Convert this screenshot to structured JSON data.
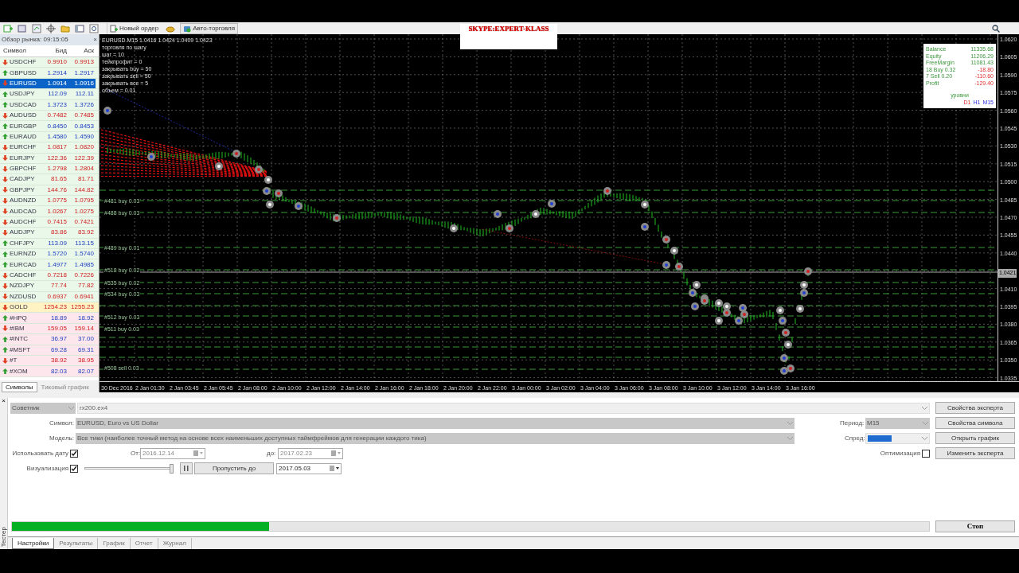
{
  "toolbar": {
    "buttons": [
      {
        "label": "Новый ордер"
      },
      {
        "label": "Авто-торговля"
      }
    ]
  },
  "market_watch": {
    "title": "Обзор рынка: 09:15:05",
    "close": "×",
    "columns": [
      "Символ",
      "Бид",
      "Аск"
    ],
    "rows": [
      {
        "symbol": "USDCHF",
        "bid": "0.9910",
        "ask": "0.9913",
        "rising": false,
        "kind": "forex",
        "selected": false
      },
      {
        "symbol": "GBPUSD",
        "bid": "1.2914",
        "ask": "1.2917",
        "rising": true,
        "kind": "forex",
        "selected": false
      },
      {
        "symbol": "EURUSD",
        "bid": "1.0914",
        "ask": "1.0916",
        "rising": false,
        "kind": "forex",
        "selected": true
      },
      {
        "symbol": "USDJPY",
        "bid": "112.09",
        "ask": "112.11",
        "rising": true,
        "kind": "forex",
        "selected": false
      },
      {
        "symbol": "USDCAD",
        "bid": "1.3723",
        "ask": "1.3726",
        "rising": true,
        "kind": "forex",
        "selected": false
      },
      {
        "symbol": "AUDUSD",
        "bid": "0.7482",
        "ask": "0.7485",
        "rising": false,
        "kind": "forex",
        "selected": false
      },
      {
        "symbol": "EURGBP",
        "bid": "0.8450",
        "ask": "0.8453",
        "rising": true,
        "kind": "forex",
        "selected": false
      },
      {
        "symbol": "EURAUD",
        "bid": "1.4580",
        "ask": "1.4590",
        "rising": true,
        "kind": "forex",
        "selected": false
      },
      {
        "symbol": "EURCHF",
        "bid": "1.0817",
        "ask": "1.0820",
        "rising": false,
        "kind": "forex",
        "selected": false
      },
      {
        "symbol": "EURJPY",
        "bid": "122.36",
        "ask": "122.39",
        "rising": false,
        "kind": "forex",
        "selected": false
      },
      {
        "symbol": "GBPCHF",
        "bid": "1.2798",
        "ask": "1.2804",
        "rising": false,
        "kind": "forex",
        "selected": false
      },
      {
        "symbol": "CADJPY",
        "bid": "81.65",
        "ask": "81.71",
        "rising": false,
        "kind": "forex",
        "selected": false
      },
      {
        "symbol": "GBPJPY",
        "bid": "144.76",
        "ask": "144.82",
        "rising": false,
        "kind": "forex",
        "selected": false
      },
      {
        "symbol": "AUDNZD",
        "bid": "1.0775",
        "ask": "1.0795",
        "rising": false,
        "kind": "forex",
        "selected": false
      },
      {
        "symbol": "AUDCAD",
        "bid": "1.0267",
        "ask": "1.0275",
        "rising": false,
        "kind": "forex",
        "selected": false
      },
      {
        "symbol": "AUDCHF",
        "bid": "0.7415",
        "ask": "0.7421",
        "rising": false,
        "kind": "forex",
        "selected": false
      },
      {
        "symbol": "AUDJPY",
        "bid": "83.86",
        "ask": "83.92",
        "rising": false,
        "kind": "forex",
        "selected": false
      },
      {
        "symbol": "CHFJPY",
        "bid": "113.09",
        "ask": "113.15",
        "rising": true,
        "kind": "forex",
        "selected": false
      },
      {
        "symbol": "EURNZD",
        "bid": "1.5720",
        "ask": "1.5740",
        "rising": true,
        "kind": "forex",
        "selected": false
      },
      {
        "symbol": "EURCAD",
        "bid": "1.4977",
        "ask": "1.4985",
        "rising": true,
        "kind": "forex",
        "selected": false
      },
      {
        "symbol": "CADCHF",
        "bid": "0.7218",
        "ask": "0.7226",
        "rising": false,
        "kind": "forex",
        "selected": false
      },
      {
        "symbol": "NZDJPY",
        "bid": "77.74",
        "ask": "77.82",
        "rising": false,
        "kind": "forex",
        "selected": false
      },
      {
        "symbol": "NZDUSD",
        "bid": "0.6937",
        "ask": "0.6941",
        "rising": false,
        "kind": "forex",
        "selected": false
      },
      {
        "symbol": "GOLD",
        "bid": "1254.23",
        "ask": "1255.23",
        "rising": false,
        "kind": "metal",
        "selected": false
      },
      {
        "symbol": "#HPQ",
        "bid": "18.89",
        "ask": "18.92",
        "rising": true,
        "kind": "stock",
        "selected": false
      },
      {
        "symbol": "#IBM",
        "bid": "159.05",
        "ask": "159.14",
        "rising": false,
        "kind": "stock",
        "selected": false
      },
      {
        "symbol": "#INTC",
        "bid": "36.97",
        "ask": "37.00",
        "rising": true,
        "kind": "stock",
        "selected": false
      },
      {
        "symbol": "#MSFT",
        "bid": "69.28",
        "ask": "69.31",
        "rising": true,
        "kind": "stock",
        "selected": false
      },
      {
        "symbol": "#T",
        "bid": "38.92",
        "ask": "38.95",
        "rising": false,
        "kind": "stock",
        "selected": false
      },
      {
        "symbol": "#XOM",
        "bid": "82.03",
        "ask": "82.07",
        "rising": true,
        "kind": "stock",
        "selected": false
      }
    ],
    "tabs": [
      {
        "label": "Символы",
        "selected": true
      },
      {
        "label": "Тиковый график",
        "selected": false
      }
    ]
  },
  "chart": {
    "header": "EURUSD.M15  1.0416 1.0424 1.0409 1.0423",
    "settings": [
      "торговля по шагу",
      "шаг = 10",
      "тейкпрофит = 0",
      "закрывать buy = 50",
      "закрывать sell = 50",
      "закрывать все = 5",
      "объем = 0.01"
    ],
    "order_labels": [
      "#481 buy 0.03",
      "#488 buy 0.03",
      "#489 buy 0.01",
      "#518 buy 0.02",
      "#535 buy 0.02",
      "#534 buy 0.03",
      "#512 buy 0.03",
      "#511 buy 0.03",
      "#508 sell 0.03"
    ],
    "banner": "SKYPE:EXPERT-KLASS",
    "info": {
      "rows": [
        {
          "label": "Balance",
          "value": "11335.68",
          "negative": false
        },
        {
          "label": "Equity",
          "value": "11206.29",
          "negative": false
        },
        {
          "label": "FreeMargin",
          "value": "11081.43",
          "negative": false
        },
        {
          "label": "18 Buy 0.32",
          "value": "-18.80",
          "negative": true
        },
        {
          "label": "7 Sell 0.20",
          "value": "-110.60",
          "negative": true
        },
        {
          "label": "Profit",
          "value": "-129.40",
          "negative": true
        }
      ],
      "levels_title": "уровни",
      "timeframes": [
        {
          "label": "D1",
          "highlighted": true
        },
        {
          "label": "H1",
          "highlighted": false
        },
        {
          "label": "M15",
          "highlighted": false
        }
      ]
    },
    "price_axis": [
      "1.0620",
      "1.0605",
      "1.0590",
      "1.0575",
      "1.0560",
      "1.0545",
      "1.0530",
      "1.0515",
      "1.0500",
      "1.0485",
      "1.0470",
      "1.0455",
      "1.0440",
      "1.0410",
      "1.0395",
      "1.0380",
      "1.0365",
      "1.0350",
      "1.0335"
    ],
    "current_price": "1.0421",
    "time_axis": [
      "30 Dec 2016",
      "2 Jan 01:30",
      "2 Jan 03:45",
      "2 Jan 05:45",
      "2 Jan 08:00",
      "2 Jan 10:00",
      "2 Jan 12:00",
      "2 Jan 14:00",
      "2 Jan 16:00",
      "2 Jan 18:00",
      "2 Jan 20:00",
      "2 Jan 22:00",
      "3 Jan 00:00",
      "3 Jan 02:00",
      "3 Jan 04:00",
      "3 Jan 06:00",
      "3 Jan 08:00",
      "3 Jan 10:00",
      "3 Jan 12:00",
      "3 Jan 14:00",
      "3 Jan 16:00"
    ]
  },
  "tester": {
    "side_label": "Тестер",
    "close": "×",
    "type_select": "Советник",
    "expert_file": "rx200.ex4",
    "symbol_label": "Символ:",
    "symbol": "EURUSD, Euro vs US Dollar",
    "model_label": "Модель:",
    "model": "Все тики (наиболее точный метод на основе всех наименьших доступных таймфреймов для генерации каждого тика)",
    "period_label": "Период:",
    "period": "M15",
    "spread_label": "Спред:",
    "use_date": {
      "label": "Использовать дату",
      "checked": true
    },
    "from_label": "От:",
    "from": "2016.12.14",
    "to_label": "до:",
    "to": "2017.02.23",
    "optimization": {
      "label": "Оптимизация",
      "checked": false
    },
    "visualization": {
      "label": "Визуализация",
      "checked": true
    },
    "speed": {
      "level": 1
    },
    "skip_button": "Пропустить до",
    "skip_date": "2017.05.03",
    "progress": {
      "level": 0.28
    },
    "buttons": [
      "Свойства эксперта",
      "Свойства символа",
      "Открыть график",
      "Изменить эксперта"
    ],
    "stop_button": "Стоп",
    "tabs": [
      {
        "label": "Настройки",
        "selected": true
      },
      {
        "label": "Результаты",
        "selected": false
      },
      {
        "label": "График",
        "selected": false
      },
      {
        "label": "Отчет",
        "selected": false
      },
      {
        "label": "Журнал",
        "selected": false
      }
    ]
  }
}
